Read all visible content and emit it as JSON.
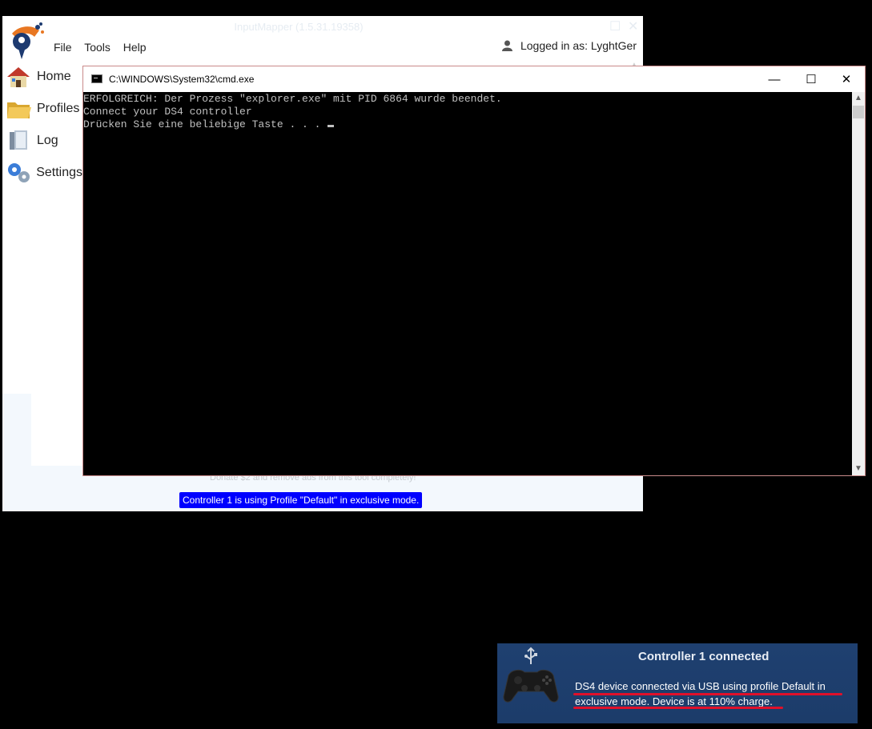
{
  "inputmapper": {
    "title": "InputMapper (1.5.31.19358)",
    "menu": [
      "File",
      "Tools",
      "Help"
    ],
    "user_label": "Logged in as: LyghtGer",
    "nav": [
      {
        "label": "Home",
        "icon": "house-icon"
      },
      {
        "label": "Profiles",
        "icon": "folder-icon"
      },
      {
        "label": "Log",
        "icon": "log-book-icon"
      },
      {
        "label": "Settings",
        "icon": "gears-icon"
      }
    ],
    "donate_text": "Donate $2 and remove ads from this tool completely!",
    "status_badge": "Controller 1 is using Profile \"Default\" in exclusive mode.",
    "colors": {
      "badge_bg": "#0000ff"
    }
  },
  "cmd": {
    "title": "C:\\WINDOWS\\System32\\cmd.exe",
    "lines": [
      "ERFOLGREICH: Der Prozess \"explorer.exe\" mit PID 6864 wurde beendet.",
      "Connect your DS4 controller",
      "Drücken Sie eine beliebige Taste . . . "
    ],
    "minimize_symbol": "—",
    "maximize_symbol": "☐",
    "close_symbol": "✕"
  },
  "notification": {
    "title": "Controller 1 connected",
    "message": "DS4 device connected via USB using profile Default in exclusive mode. Device is at 110% charge.",
    "icon": "usb-gamepad-icon",
    "colors": {
      "background": "#1f4070",
      "underline": "#e0102a"
    }
  }
}
